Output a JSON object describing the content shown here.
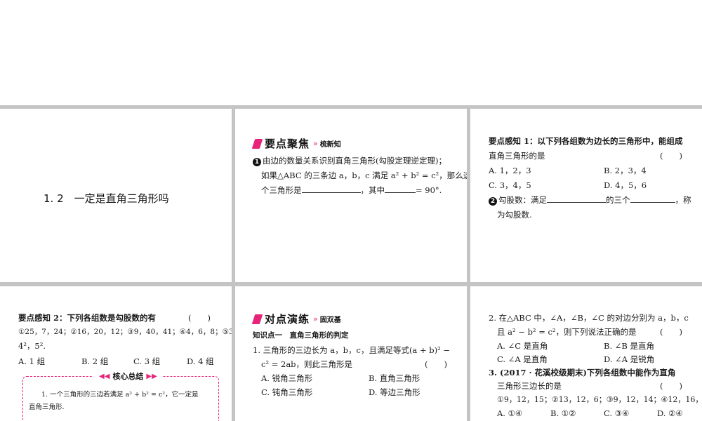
{
  "panel1": {
    "title": "1. 2　一定是直角三角形吗"
  },
  "panel2": {
    "header": {
      "title": "要点聚焦",
      "subtitle": "梳新知"
    },
    "item1_marker": "1",
    "lines": [
      "由边的数量关系识别直角三角形(勾股定理逆定理)；",
      "如果△ABC 的三条边 a，b，c 满足 a² + b² = c²，那么这",
      "个三角形是",
      "，其中",
      "= 90°."
    ]
  },
  "panel3": {
    "q1_line1": "要点感知 1：以下列各组数为边长的三角形中，能组成",
    "q1_line2": "直角三角形的是",
    "paren": "(　　)",
    "opts": [
      "A. 1，2，3",
      "B. 2，3，4",
      "C. 3，4，5",
      "D. 4，5，6"
    ],
    "item2_marker": "2",
    "item2_a": "勾股数：满足",
    "item2_b": "的三个",
    "item2_c": "，称",
    "item2_line2": "为勾股数."
  },
  "panel4": {
    "q2_line1": "要点感知 2：下列各组数是勾股数的有",
    "paren": "(　　)",
    "q2_line2": "①25，7，24；②16，20，12；③9，40，41；④4，6，8；⑤3²，",
    "q2_line3": "4²，5².",
    "opts": [
      "A. 1 组",
      "B. 2 组",
      "C. 3 组",
      "D. 4 组"
    ],
    "core": {
      "title": "核心总结",
      "line1": "1. 一个三角形的三边若满足 a² + b² = c²，它一定是",
      "line2": "直角三角形."
    }
  },
  "panel5": {
    "header": {
      "title": "对点演练",
      "subtitle": "固双基"
    },
    "kp": "知识点一　直角三角形的判定",
    "q1_line1": "1. 三角形的三边长为 a，b，c，且满足等式(a + b)² −",
    "q1_line2": "c² = 2ab，则此三角形是",
    "paren": "(　　)",
    "opts": [
      "A. 锐角三角形",
      "B. 直角三角形",
      "C. 钝角三角形",
      "D. 等边三角形"
    ]
  },
  "panel6": {
    "q2_line1": "2. 在△ABC 中，∠A，∠B，∠C 的对边分别为 a，b，c",
    "q2_line2": "且 a² − b² = c²，则下列说法正确的是",
    "paren": "(　　)",
    "q2_opts": [
      "A. ∠C 是直角",
      "B. ∠B 是直角",
      "C. ∠A 是直角",
      "D. ∠A 是锐角"
    ],
    "q3_line1": "3. (2017 · 花溪校级期末)下列各组数中能作为直角",
    "q3_line2": "三角形三边长的是",
    "q3_line3": "①9，12，15；②13，12，6；③9，12，14；④12，16，20.",
    "q3_opts": [
      "A. ①④",
      "B. ①②",
      "C. ③④",
      "D. ②④"
    ]
  }
}
